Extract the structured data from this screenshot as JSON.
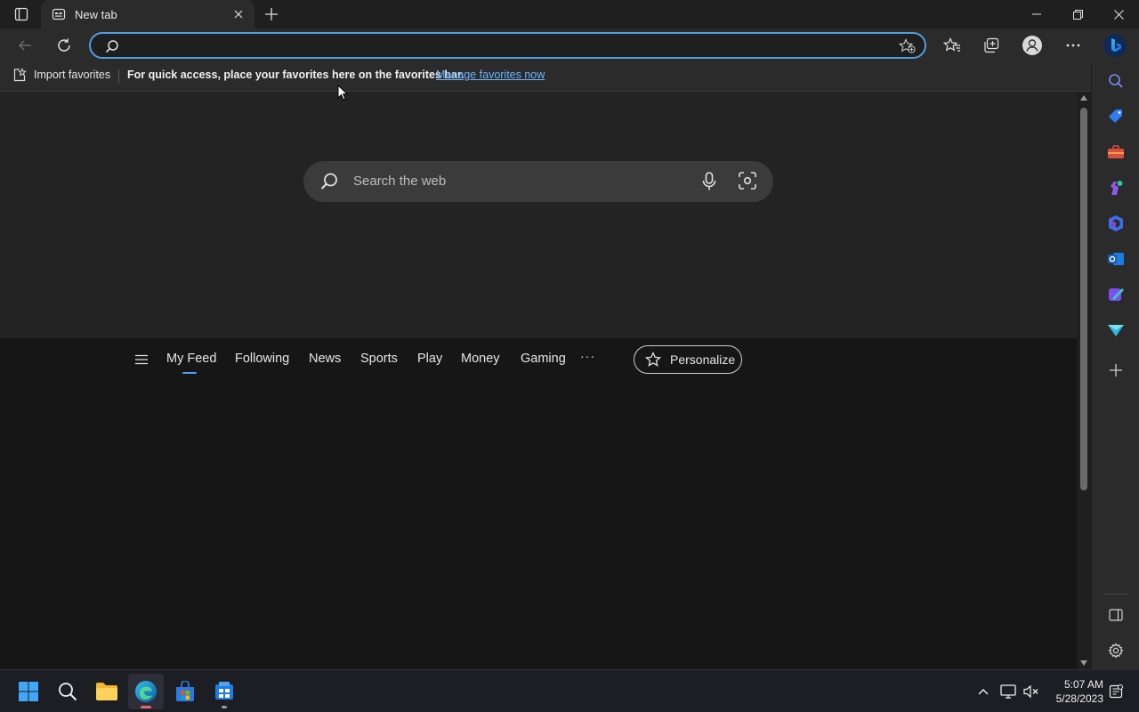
{
  "browser": {
    "tab": {
      "title": "New tab"
    },
    "address_bar": {
      "value": "",
      "placeholder": ""
    },
    "favorites_bar": {
      "import_label": "Import favorites",
      "message": "For quick access, place your favorites here on the favorites bar.",
      "link_label": "Manage favorites now"
    }
  },
  "newtab": {
    "search": {
      "placeholder": "Search the web"
    },
    "feed_nav": {
      "items": [
        {
          "label": "My Feed"
        },
        {
          "label": "Following"
        },
        {
          "label": "News"
        },
        {
          "label": "Sports"
        },
        {
          "label": "Play"
        },
        {
          "label": "Money"
        },
        {
          "label": "Gaming"
        }
      ],
      "more_label": "···",
      "personalize_label": "Personalize"
    }
  },
  "sidebar": {
    "icons": [
      "search-icon",
      "shopping-tag-icon",
      "tools-icon",
      "games-icon",
      "office-icon",
      "outlook-icon",
      "designer-icon",
      "drop-icon",
      "add-icon"
    ]
  },
  "taskbar": {
    "clock": {
      "time": "5:07 AM",
      "date": "5/28/2023"
    }
  },
  "colors": {
    "accent": "#4f9fe3",
    "link": "#6cb4ff",
    "background": "#161616"
  }
}
